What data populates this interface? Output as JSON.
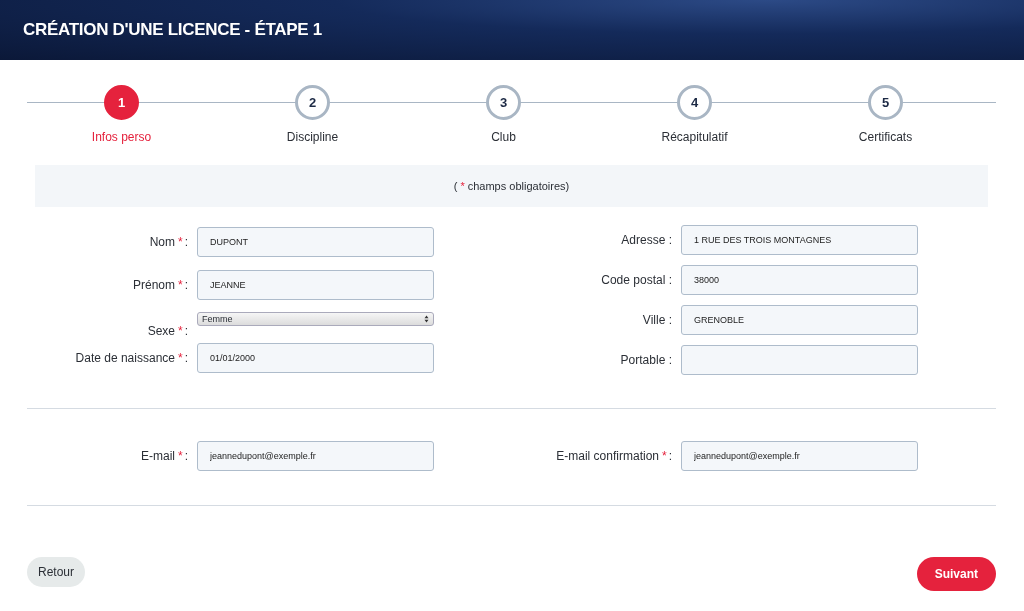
{
  "header": {
    "title": "CRÉATION D'UNE LICENCE - ÉTAPE 1"
  },
  "steps": [
    {
      "number": "1",
      "label": "Infos perso",
      "selected": true
    },
    {
      "number": "2",
      "label": "Discipline",
      "selected": false
    },
    {
      "number": "3",
      "label": "Club",
      "selected": false
    },
    {
      "number": "4",
      "label": "Récapitulatif",
      "selected": false
    },
    {
      "number": "5",
      "label": "Certificats",
      "selected": false
    }
  ],
  "note": {
    "open": "(",
    "mark": "*",
    "text": "champs obligatoires)"
  },
  "left_fields": [
    {
      "kind": "text",
      "label": "Nom",
      "mark": "*",
      "colon": ":",
      "value": "DUPONT"
    },
    {
      "kind": "text",
      "label": "Prénom",
      "mark": "*",
      "colon": ":",
      "value": "JEANNE"
    },
    {
      "kind": "select",
      "label": "Sexe",
      "mark": "*",
      "colon": ":",
      "value": "Femme"
    },
    {
      "kind": "text",
      "label": "Date de naissance",
      "mark": "*",
      "colon": ":",
      "value": "01/01/2000"
    }
  ],
  "right_fields": [
    {
      "kind": "text",
      "label": "Adresse",
      "colon": ":",
      "value": "1 RUE DES TROIS MONTAGNES"
    },
    {
      "kind": "text",
      "label": "Code postal",
      "colon": ":",
      "value": "38000"
    },
    {
      "kind": "text",
      "label": "Ville",
      "colon": ":",
      "value": "GRENOBLE"
    },
    {
      "kind": "text",
      "label": "Portable",
      "colon": ":"
    }
  ],
  "email_fields": [
    {
      "kind": "text",
      "label": "E-mail",
      "mark": "*",
      "colon": ":",
      "value": "jeannedupont@exemple.fr"
    },
    {
      "kind": "text",
      "label": "E-mail confirmation",
      "mark": "*",
      "colon": ":",
      "value": "jeannedupont@exemple.fr"
    }
  ],
  "buttons": {
    "back": "Retour",
    "next": "Suivant"
  }
}
